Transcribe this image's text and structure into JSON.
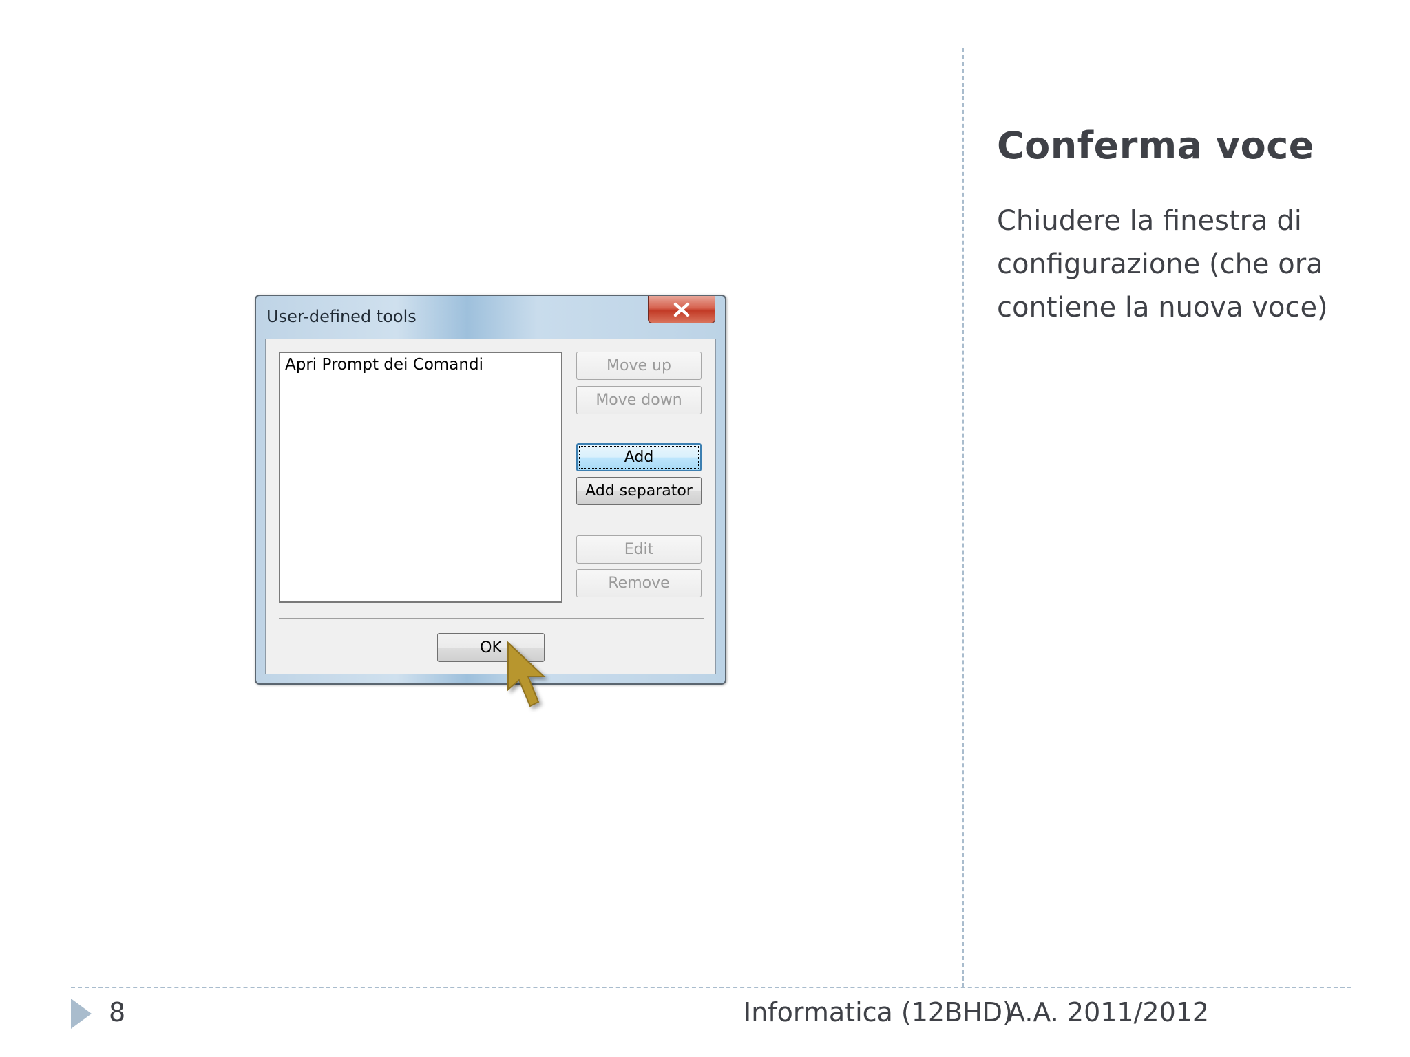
{
  "slide": {
    "title": "Conferma voce",
    "body": "Chiudere la finestra di configurazione (che ora contiene la nuova voce)"
  },
  "footer": {
    "page_number": "8",
    "course": "Informatica (12BHD)",
    "academic_year": "A.A. 2011/2012"
  },
  "dialog": {
    "title": "User-defined tools",
    "close_icon": "close-x-icon",
    "list_items": [
      "Apri Prompt dei Comandi"
    ],
    "buttons": {
      "move_up": "Move up",
      "move_down": "Move down",
      "add": "Add",
      "add_separator": "Add separator",
      "edit": "Edit",
      "remove": "Remove",
      "ok": "OK"
    }
  },
  "colors": {
    "text": "#3f4147",
    "divider": "#a9bccd",
    "cursor": "#b8962e",
    "close_button": "#c23a26"
  }
}
